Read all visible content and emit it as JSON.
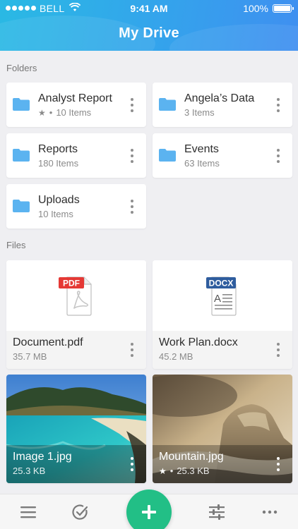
{
  "status_bar": {
    "carrier": "BELL",
    "time": "9:41 AM",
    "battery": "100%"
  },
  "header": {
    "title": "My Drive"
  },
  "sections": {
    "folders": "Folders",
    "files": "Files"
  },
  "folders": [
    {
      "name": "Analyst Report",
      "items": "10 Items",
      "starred": true
    },
    {
      "name": "Angela’s Data",
      "items": "3 Items",
      "starred": false
    },
    {
      "name": "Reports",
      "items": "180 Items",
      "starred": false
    },
    {
      "name": "Events",
      "items": "63 Items",
      "starred": false
    },
    {
      "name": "Uploads",
      "items": "10 Items",
      "starred": false
    }
  ],
  "files": [
    {
      "name": "Document.pdf",
      "size": "35.7 MB",
      "type_label": "PDF",
      "starred": false
    },
    {
      "name": "Work Plan.docx",
      "size": "45.2 MB",
      "type_label": "DOCX",
      "starred": false
    },
    {
      "name": "Image 1.jpg",
      "size": "25.3 KB",
      "starred": false
    },
    {
      "name": "Mountain.jpg",
      "size": "25.3 KB",
      "starred": true
    }
  ],
  "bottom_bar": {
    "items": [
      "menu-icon",
      "check-circle-icon",
      "add-icon",
      "sliders-icon",
      "more-icon"
    ]
  },
  "colors": {
    "header_start": "#2ab9e4",
    "header_end": "#3f8ff0",
    "folder_icon": "#5bb3f0",
    "pdf_badge": "#e53935",
    "docx_badge": "#2f5d9e",
    "fab": "#22bf86"
  }
}
